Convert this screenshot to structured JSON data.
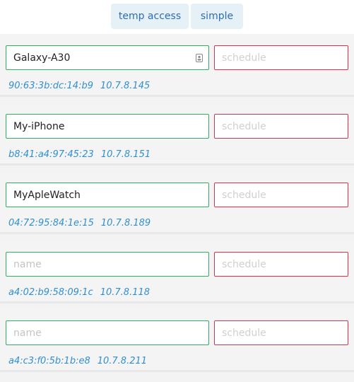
{
  "toolbar": {
    "temp_access_label": "temp access",
    "simple_label": "simple"
  },
  "devices": [
    {
      "name": "Galaxy-A30",
      "name_placeholder": "name",
      "schedule": "",
      "schedule_placeholder": "schedule",
      "mac": "90:63:3b:dc:14:b9",
      "ip": "10.7.8.145"
    },
    {
      "name": "My-iPhone",
      "name_placeholder": "name",
      "schedule": "",
      "schedule_placeholder": "schedule",
      "mac": "b8:41:a4:97:45:23",
      "ip": "10.7.8.151"
    },
    {
      "name": "MyApleWatch",
      "name_placeholder": "name",
      "schedule": "",
      "schedule_placeholder": "schedule",
      "mac": "04:72:95:84:1e:15",
      "ip": "10.7.8.189"
    },
    {
      "name": "",
      "name_placeholder": "name",
      "schedule": "",
      "schedule_placeholder": "schedule",
      "mac": "a4:02:b9:58:09:1c",
      "ip": "10.7.8.118"
    },
    {
      "name": "",
      "name_placeholder": "name",
      "schedule": "",
      "schedule_placeholder": "schedule",
      "mac": "a4:c3:f0:5b:1b:e8",
      "ip": "10.7.8.211"
    }
  ],
  "icons": {
    "autofill": "contact-card-icon"
  },
  "colors": {
    "name_border": "#2fb05f",
    "schedule_border": "#d8334a",
    "meta_text": "#2f8fd0",
    "button_text": "#2d6db4",
    "button_bg": "#e6f0f7"
  }
}
